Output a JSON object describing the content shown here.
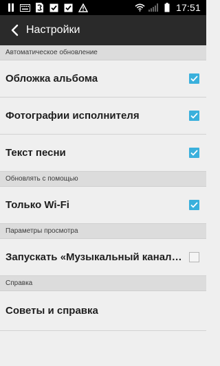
{
  "status_bar": {
    "time": "17:51",
    "left_icons": [
      "pause-icon",
      "keyboard-icon",
      "sim-icon",
      "checkbox-icon",
      "checkbox-icon",
      "warning-icon"
    ],
    "right_icons": [
      "wifi-icon",
      "signal-icon",
      "battery-icon"
    ]
  },
  "action_bar": {
    "title": "Настройки"
  },
  "sections": [
    {
      "header": "Автоматическое обновление",
      "items": [
        {
          "label": "Обложка альбома",
          "checked": true
        },
        {
          "label": "Фотографии исполнителя",
          "checked": true
        },
        {
          "label": "Текст песни",
          "checked": true
        }
      ]
    },
    {
      "header": "Обновлять с помощью",
      "items": [
        {
          "label": "Только Wi-Fi",
          "checked": true
        }
      ]
    },
    {
      "header": "Параметры просмотра",
      "items": [
        {
          "label": "Запускать «Музыкальный канал» ав...",
          "checked": false
        }
      ]
    },
    {
      "header": "Справка",
      "items": [
        {
          "label": "Советы и справка"
        }
      ]
    }
  ],
  "colors": {
    "accent": "#3ab0dc",
    "action_bar": "#2a2a2a",
    "background": "#efefef",
    "section_header": "#dcdcdc"
  }
}
